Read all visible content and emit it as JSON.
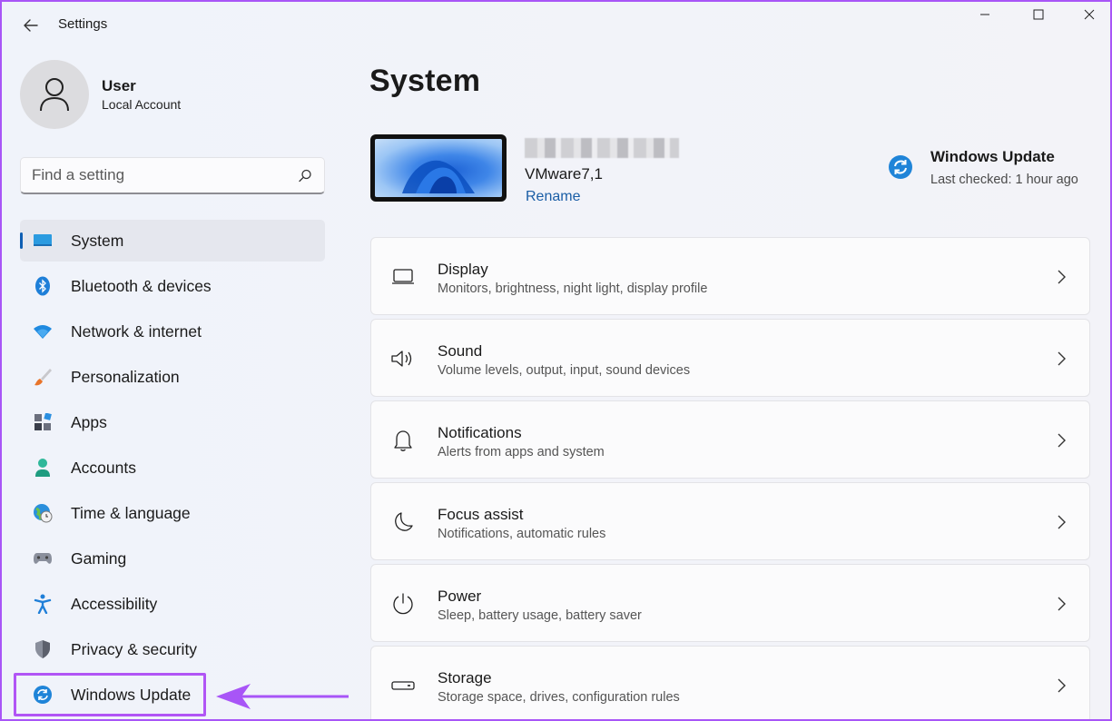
{
  "window": {
    "title": "Settings"
  },
  "user": {
    "name": "User",
    "account_type": "Local Account"
  },
  "search": {
    "placeholder": "Find a setting"
  },
  "sidebar": {
    "items": [
      {
        "label": "System",
        "icon": "system-icon",
        "active": true
      },
      {
        "label": "Bluetooth & devices",
        "icon": "bluetooth-icon"
      },
      {
        "label": "Network & internet",
        "icon": "wifi-icon"
      },
      {
        "label": "Personalization",
        "icon": "brush-icon"
      },
      {
        "label": "Apps",
        "icon": "apps-icon"
      },
      {
        "label": "Accounts",
        "icon": "person-icon"
      },
      {
        "label": "Time & language",
        "icon": "globe-clock-icon"
      },
      {
        "label": "Gaming",
        "icon": "gamepad-icon"
      },
      {
        "label": "Accessibility",
        "icon": "accessibility-icon"
      },
      {
        "label": "Privacy & security",
        "icon": "shield-icon"
      },
      {
        "label": "Windows Update",
        "icon": "sync-icon",
        "highlighted": true
      }
    ]
  },
  "main": {
    "title": "System",
    "device": {
      "model": "VMware7,1",
      "rename_label": "Rename"
    },
    "windows_update": {
      "title": "Windows Update",
      "status": "Last checked: 1 hour ago"
    },
    "cards": [
      {
        "title": "Display",
        "subtitle": "Monitors, brightness, night light, display profile",
        "icon": "monitor-icon"
      },
      {
        "title": "Sound",
        "subtitle": "Volume levels, output, input, sound devices",
        "icon": "speaker-icon"
      },
      {
        "title": "Notifications",
        "subtitle": "Alerts from apps and system",
        "icon": "bell-icon"
      },
      {
        "title": "Focus assist",
        "subtitle": "Notifications, automatic rules",
        "icon": "moon-icon"
      },
      {
        "title": "Power",
        "subtitle": "Sleep, battery usage, battery saver",
        "icon": "power-icon"
      },
      {
        "title": "Storage",
        "subtitle": "Storage space, drives, configuration rules",
        "icon": "storage-icon"
      }
    ]
  },
  "colors": {
    "accent": "#0f5fb3",
    "highlight": "#a855f7"
  }
}
